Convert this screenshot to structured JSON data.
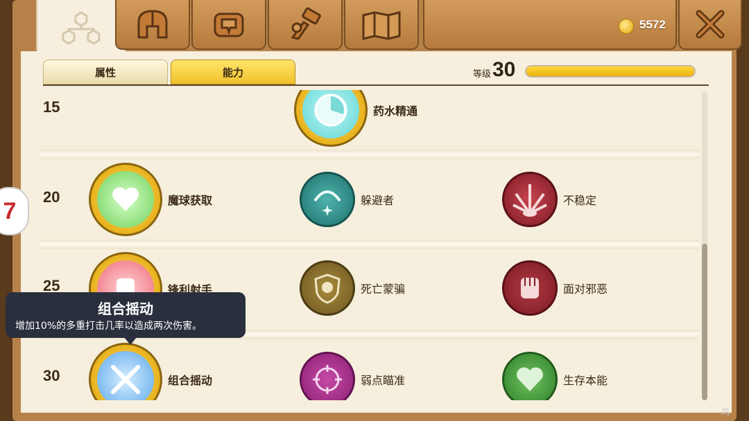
{
  "header": {
    "tabs": [
      {
        "icon": "skill-tree-icon",
        "active": true
      },
      {
        "icon": "helmet-icon",
        "active": false
      },
      {
        "icon": "backpack-icon",
        "active": false
      },
      {
        "icon": "hammer-icon",
        "active": false
      },
      {
        "icon": "map-icon",
        "active": false
      }
    ],
    "gold": "5572",
    "close_icon": "close-icon"
  },
  "subtabs": {
    "attributes_label": "属性",
    "abilities_label": "能力",
    "active": "abilities"
  },
  "level": {
    "label": "等级",
    "value": "30",
    "progress": 1.0
  },
  "rows": [
    {
      "level": "15",
      "skills": [
        {
          "name": "药水精通",
          "icon": "potion-clock-icon",
          "selected": true
        }
      ]
    },
    {
      "level": "20",
      "skills": [
        {
          "name": "魔球获取",
          "icon": "heart-orb-icon",
          "selected": true
        },
        {
          "name": "躲避者",
          "icon": "dodge-icon",
          "selected": false
        },
        {
          "name": "不稳定",
          "icon": "unstable-icon",
          "selected": false
        }
      ]
    },
    {
      "level": "25",
      "skills": [
        {
          "name": "锋利射手",
          "icon": "fist-icon",
          "selected": true
        },
        {
          "name": "死亡蒙骗",
          "icon": "skull-shield-icon",
          "selected": false
        },
        {
          "name": "面对邪恶",
          "icon": "fist-icon",
          "selected": false
        }
      ]
    },
    {
      "level": "30",
      "skills": [
        {
          "name": "组合摇动",
          "icon": "crossed-swords-icon",
          "selected": true
        },
        {
          "name": "弱点瞄准",
          "icon": "crosshair-icon",
          "selected": false
        },
        {
          "name": "生存本能",
          "icon": "heart-icon",
          "selected": false
        }
      ]
    }
  ],
  "tooltip": {
    "title": "组合摇动",
    "description": "增加10%的多重打击几率以造成两次伤害。"
  },
  "side_badge": "7",
  "watermark": "鸡",
  "colors": {
    "wood": "#c88f50",
    "parchment": "#f6efdd",
    "gold": "#f1c12a",
    "tooltip_bg": "#2a2f3d"
  }
}
